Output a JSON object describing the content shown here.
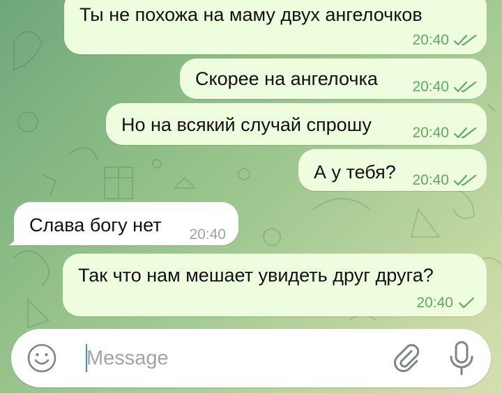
{
  "messages": [
    {
      "text": "Ты не похожа на маму двух ангелочков",
      "time": "20:40",
      "direction": "out",
      "status": "read"
    },
    {
      "text": "Скорее на ангелочка",
      "time": "20:40",
      "direction": "out",
      "status": "read"
    },
    {
      "text": "Но на всякий случай спрошу",
      "time": "20:40",
      "direction": "out",
      "status": "read"
    },
    {
      "text": "А у тебя?",
      "time": "20:40",
      "direction": "out",
      "status": "read"
    },
    {
      "text": "Слава богу нет",
      "time": "20:40",
      "direction": "in"
    },
    {
      "text": "Так что нам мешает увидеть друг друга?",
      "time": "20:40",
      "direction": "out",
      "status": "sent"
    }
  ],
  "input": {
    "placeholder": "Message",
    "value": ""
  },
  "icons": {
    "emoji": "emoji-icon",
    "attach": "paperclip-icon",
    "mic": "microphone-icon",
    "read": "double-check-icon",
    "sent": "single-check-icon"
  },
  "colors": {
    "outgoing_bubble": "#effddf",
    "incoming_bubble": "#ffffff",
    "check": "#5daa62",
    "caret": "#3b8fe0"
  }
}
